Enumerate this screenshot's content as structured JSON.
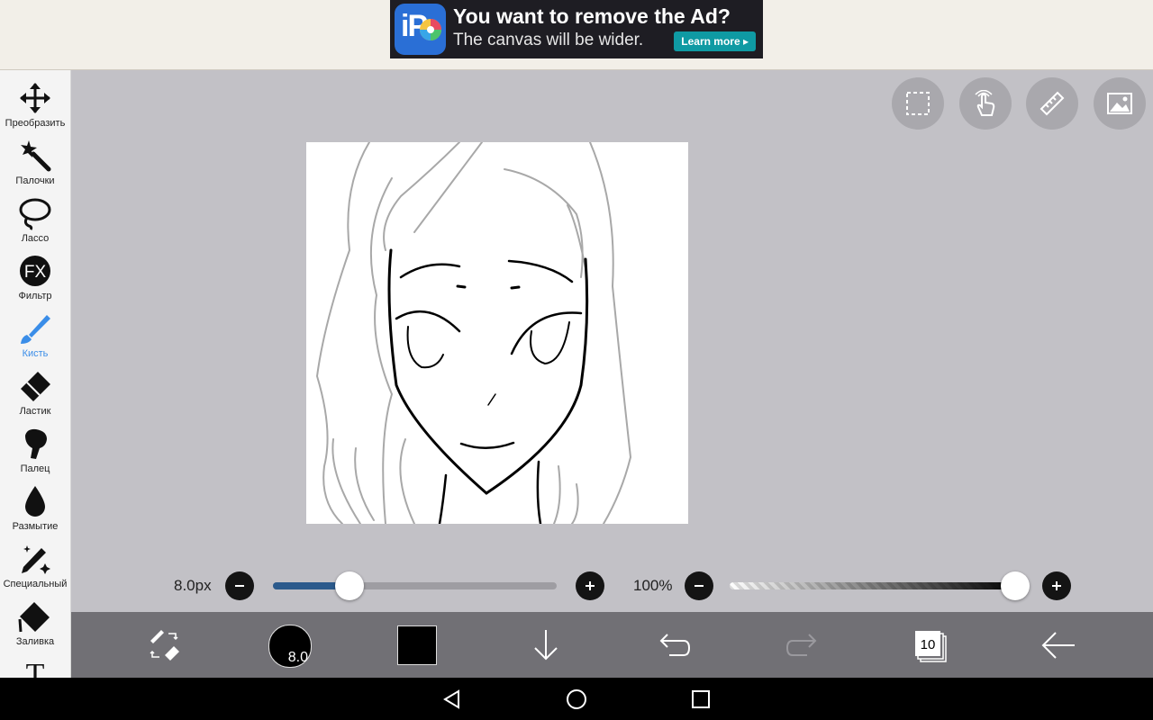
{
  "ad": {
    "title": "You want to remove the Ad?",
    "subtitle": "The canvas will be wider.",
    "button": "Learn more ▸",
    "logo_text": "iP"
  },
  "tools": [
    {
      "label": "Преобразить",
      "icon": "move-icon"
    },
    {
      "label": "Палочки",
      "icon": "magic-wand-icon"
    },
    {
      "label": "Лассо",
      "icon": "lasso-icon"
    },
    {
      "label": "Фильтр",
      "icon": "fx-icon",
      "glyph": "FX"
    },
    {
      "label": "Кисть",
      "icon": "brush-icon",
      "active": true
    },
    {
      "label": "Ластик",
      "icon": "eraser-icon"
    },
    {
      "label": "Палец",
      "icon": "finger-icon"
    },
    {
      "label": "Размытие",
      "icon": "blur-drop-icon"
    },
    {
      "label": "Специальный",
      "icon": "special-pen-icon"
    },
    {
      "label": "Заливка",
      "icon": "fill-bucket-icon"
    },
    {
      "label": "",
      "icon": "text-icon",
      "glyph": "T"
    }
  ],
  "top_tools": [
    "selection-icon",
    "hand-gesture-icon",
    "ruler-icon",
    "image-icon"
  ],
  "brush_size": {
    "label": "8.0px",
    "value_fraction": 0.27
  },
  "opacity": {
    "label": "100%",
    "value_fraction": 1.0
  },
  "action_bar": {
    "brush_preview_value": "8.0",
    "layers_count": "10",
    "current_color": "#000000"
  },
  "colors": {
    "accent": "#3a8de8",
    "workspace": "#c2c1c6",
    "action_bar": "#717075",
    "ad_button": "#0f9aa3",
    "slider_fill": "#2b5a8c"
  }
}
